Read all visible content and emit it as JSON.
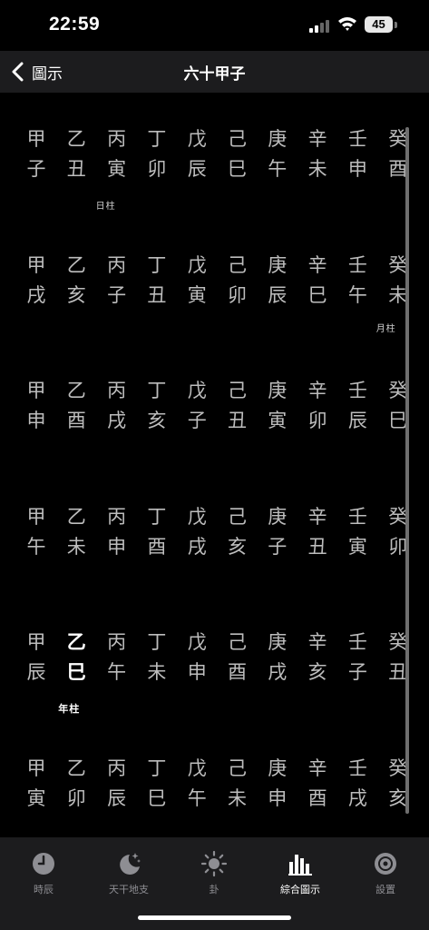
{
  "status": {
    "time": "22:59",
    "battery": "45"
  },
  "nav": {
    "back_label": "圖示",
    "title": "六十甲子"
  },
  "grid": {
    "stems": [
      "甲",
      "乙",
      "丙",
      "丁",
      "戊",
      "己",
      "庚",
      "辛",
      "壬",
      "癸"
    ],
    "rows": [
      [
        "子",
        "丑",
        "寅",
        "卯",
        "辰",
        "巳",
        "午",
        "未",
        "申",
        "酉"
      ],
      [
        "戌",
        "亥",
        "子",
        "丑",
        "寅",
        "卯",
        "辰",
        "巳",
        "午",
        "未"
      ],
      [
        "申",
        "酉",
        "戌",
        "亥",
        "子",
        "丑",
        "寅",
        "卯",
        "辰",
        "巳"
      ],
      [
        "午",
        "未",
        "申",
        "酉",
        "戌",
        "亥",
        "子",
        "丑",
        "寅",
        "卯"
      ],
      [
        "辰",
        "巳",
        "午",
        "未",
        "申",
        "酉",
        "戌",
        "亥",
        "子",
        "丑"
      ],
      [
        "寅",
        "卯",
        "辰",
        "巳",
        "午",
        "未",
        "申",
        "酉",
        "戌",
        "亥"
      ]
    ],
    "highlight": {
      "row": 4,
      "col": 1
    },
    "pillars": [
      {
        "label": "日柱",
        "row": 0,
        "col": 2,
        "bold": false
      },
      {
        "label": "月柱",
        "row": 1,
        "col": 9,
        "bold": false
      },
      {
        "label": "年柱",
        "row": 4,
        "col": 1,
        "bold": true
      }
    ]
  },
  "tabs": [
    {
      "label": "時辰",
      "icon": "clock-icon",
      "active": false
    },
    {
      "label": "天干地支",
      "icon": "moon-stars-icon",
      "active": false
    },
    {
      "label": "卦",
      "icon": "sun-icon",
      "active": false
    },
    {
      "label": "綜合圖示",
      "icon": "bar-chart-icon",
      "active": true
    },
    {
      "label": "設置",
      "icon": "gear-icon",
      "active": false
    }
  ],
  "colors": {
    "background": "#000000",
    "bar": "#1c1c1e",
    "text_dim": "#bdbdbd",
    "tab_inactive": "#8e8e93"
  }
}
